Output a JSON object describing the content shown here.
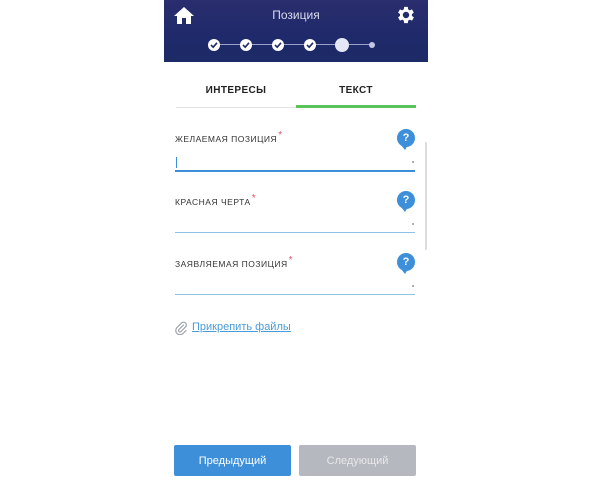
{
  "header": {
    "title": "Позиция",
    "home_icon": "home-icon",
    "settings_icon": "gear-icon",
    "bg_color": "#1f2a6a",
    "steps": {
      "total": 6,
      "completed": 4,
      "current": 5
    }
  },
  "tabs": [
    {
      "label": "ИНТЕРЕСЫ",
      "active": false
    },
    {
      "label": "ТЕКСТ",
      "active": true
    }
  ],
  "fields": [
    {
      "label": "ЖЕЛАЕМАЯ ПОЗИЦИЯ",
      "required": "*",
      "value": "",
      "help": "?"
    },
    {
      "label": "КРАСНАЯ ЧЕРТА",
      "required": "*",
      "value": "",
      "help": "?"
    },
    {
      "label": "ЗАЯВЛЯЕМАЯ ПОЗИЦИЯ",
      "required": "*",
      "value": "",
      "help": "?"
    }
  ],
  "attach": {
    "label": "Прикрепить файлы",
    "icon": "paperclip-icon"
  },
  "buttons": {
    "prev": "Предыдущий",
    "next": "Следующий"
  },
  "colors": {
    "accent": "#3d8fd9",
    "tab_indicator": "#5cc35b",
    "required": "#e0566a",
    "disabled": "#b5b8bf"
  }
}
